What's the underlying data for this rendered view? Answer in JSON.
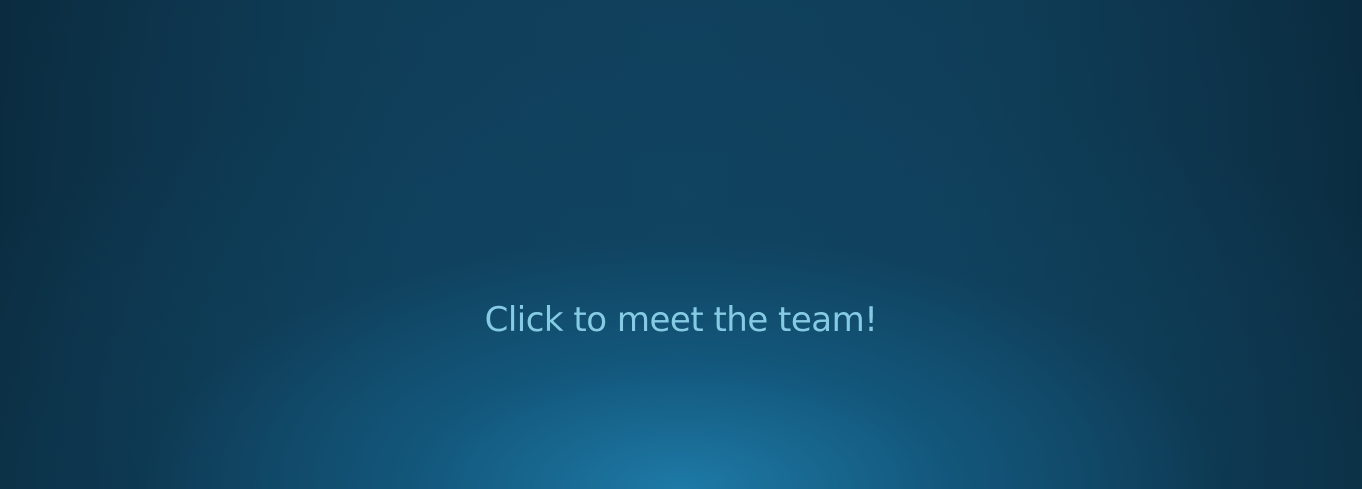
{
  "main": {
    "cta_text": "Click to meet the team!"
  },
  "colors": {
    "background_top": "#0d3550",
    "background_glow": "#1e7daa",
    "text": "#86cbe4"
  }
}
